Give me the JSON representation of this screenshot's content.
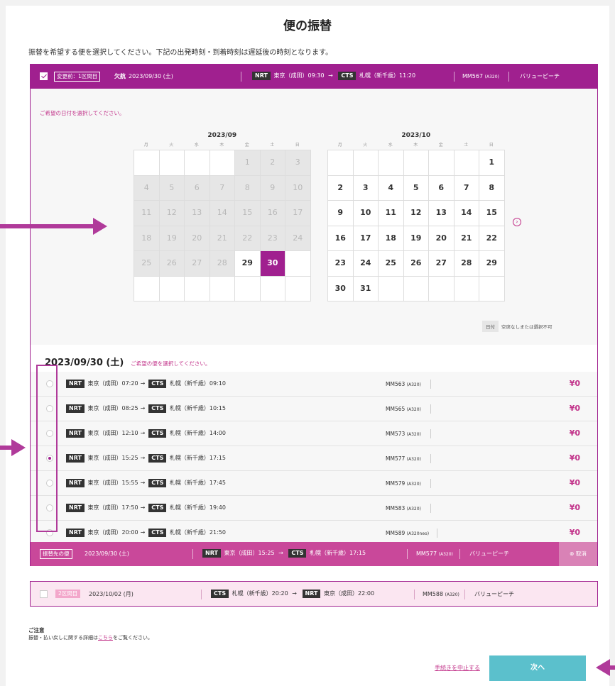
{
  "page_title": "便の振替",
  "intro": "振替を希望する便を選択してください。下記の出発時刻・到着時刻は遅延後の時刻となります。",
  "segment1": {
    "before_tag": "変更前：1区間目",
    "status": "欠航",
    "date": "2023/09/30 (土)",
    "from_code": "NRT",
    "from_text": "東京（成田）09:30",
    "to_code": "CTS",
    "to_text": "札幌（新千歳）11:20",
    "flight": "MM567",
    "aircraft": "(A320)",
    "fare": "バリューピーチ",
    "date_prompt": "ご希望の日付を選択してください。"
  },
  "calendar": {
    "weekdays": [
      "月",
      "火",
      "水",
      "木",
      "金",
      "土",
      "日"
    ],
    "month1": {
      "label": "2023/09",
      "cells": [
        "",
        "",
        "",
        "",
        "1",
        "2",
        "3",
        "4",
        "5",
        "6",
        "7",
        "8",
        "9",
        "10",
        "11",
        "12",
        "13",
        "14",
        "15",
        "16",
        "17",
        "18",
        "19",
        "20",
        "21",
        "22",
        "23",
        "24",
        "25",
        "26",
        "27",
        "28",
        "29",
        "30",
        "",
        "",
        "",
        "",
        "",
        "",
        "",
        ""
      ],
      "disabled_until": 28,
      "selected": "30"
    },
    "month2": {
      "label": "2023/10",
      "cells": [
        "",
        "",
        "",
        "",
        "",
        "",
        "1",
        "2",
        "3",
        "4",
        "5",
        "6",
        "7",
        "8",
        "9",
        "10",
        "11",
        "12",
        "13",
        "14",
        "15",
        "16",
        "17",
        "18",
        "19",
        "20",
        "21",
        "22",
        "23",
        "24",
        "25",
        "26",
        "27",
        "28",
        "29",
        "30",
        "31",
        "",
        "",
        "",
        "",
        ""
      ]
    },
    "next_icon": "chevron-right-circle-icon",
    "legend_box": "日付",
    "legend_text": "空席なしまたは選択不可"
  },
  "flights": {
    "date": "2023/09/30 (土)",
    "prompt": "ご希望の便を選択してください。",
    "rows": [
      {
        "from": "NRT",
        "dep": "東京（成田）07:20",
        "to": "CTS",
        "arr": "札幌（新千歳）09:10",
        "flight": "MM563",
        "aircraft": "(A320)",
        "price": "¥0",
        "selected": false
      },
      {
        "from": "NRT",
        "dep": "東京（成田）08:25",
        "to": "CTS",
        "arr": "札幌（新千歳）10:15",
        "flight": "MM565",
        "aircraft": "(A320)",
        "price": "¥0",
        "selected": false
      },
      {
        "from": "NRT",
        "dep": "東京（成田）12:10",
        "to": "CTS",
        "arr": "札幌（新千歳）14:00",
        "flight": "MM573",
        "aircraft": "(A320)",
        "price": "¥0",
        "selected": false
      },
      {
        "from": "NRT",
        "dep": "東京（成田）15:25",
        "to": "CTS",
        "arr": "札幌（新千歳）17:15",
        "flight": "MM577",
        "aircraft": "(A320)",
        "price": "¥0",
        "selected": true
      },
      {
        "from": "NRT",
        "dep": "東京（成田）15:55",
        "to": "CTS",
        "arr": "札幌（新千歳）17:45",
        "flight": "MM579",
        "aircraft": "(A320)",
        "price": "¥0",
        "selected": false
      },
      {
        "from": "NRT",
        "dep": "東京（成田）17:50",
        "to": "CTS",
        "arr": "札幌（新千歳）19:40",
        "flight": "MM583",
        "aircraft": "(A320)",
        "price": "¥0",
        "selected": false
      },
      {
        "from": "NRT",
        "dep": "東京（成田）20:00",
        "to": "CTS",
        "arr": "札幌（新千歳）21:50",
        "flight": "MM589",
        "aircraft": "(A320neo)",
        "price": "¥0",
        "selected": false
      }
    ]
  },
  "selected_bar": {
    "tag": "振替先の便",
    "date": "2023/09/30 (土)",
    "from_code": "NRT",
    "from_text": "東京（成田）15:25",
    "to_code": "CTS",
    "to_text": "札幌（新千歳）17:15",
    "flight": "MM577",
    "aircraft": "(A320)",
    "fare": "バリューピーチ",
    "cancel": "取消"
  },
  "segment2": {
    "tag": "2区間目",
    "date": "2023/10/02 (月)",
    "from_code": "CTS",
    "from_text": "札幌（新千歳）20:20",
    "to_code": "NRT",
    "to_text": "東京（成田）22:00",
    "flight": "MM588",
    "aircraft": "(A320)",
    "fare": "バリューピーチ"
  },
  "notes": {
    "heading": "ご注意",
    "text_before": "振替・払い戻しに関する詳細は",
    "link": "こちら",
    "text_after": "をご覧ください。"
  },
  "actions": {
    "stop": "手続きを中止する",
    "next": "次へ"
  },
  "colors": {
    "accent": "#a0208f",
    "selected_bar": "#c9489a",
    "next_button": "#5bc0cc",
    "price": "#c2338a"
  }
}
